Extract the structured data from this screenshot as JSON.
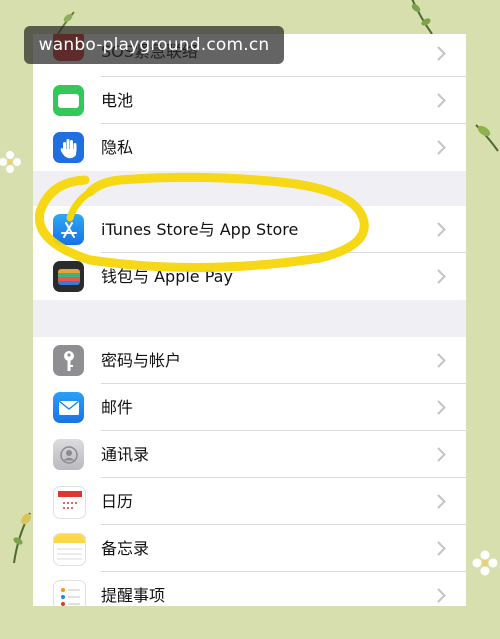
{
  "watermark": "wanbo-playground.com.cn",
  "settings": {
    "group1": [
      {
        "label": "SOS紧急联络",
        "icon": "sos-icon",
        "color": "#e3342f"
      },
      {
        "label": "电池",
        "icon": "battery-icon",
        "color": "#34c759"
      },
      {
        "label": "隐私",
        "icon": "hand-icon",
        "color": "#1f6fe0"
      }
    ],
    "group2": [
      {
        "label": "iTunes Store与 App Store",
        "icon": "app-store-icon",
        "color": "#1a8cf0"
      },
      {
        "label": "钱包与 Apple Pay",
        "icon": "wallet-icon",
        "color": "#2b2b2b"
      }
    ],
    "group3": [
      {
        "label": "密码与帐户",
        "icon": "key-icon",
        "color": "#8e8e93"
      },
      {
        "label": "邮件",
        "icon": "mail-icon",
        "color": "#1a8cf0"
      },
      {
        "label": "通讯录",
        "icon": "contacts-icon",
        "color": "#c7c7cc"
      },
      {
        "label": "日历",
        "icon": "calendar-icon",
        "color": "#ffffff"
      },
      {
        "label": "备忘录",
        "icon": "notes-icon",
        "color": "#ffd84a"
      },
      {
        "label": "提醒事项",
        "icon": "reminders-icon",
        "color": "#ffffff"
      }
    ]
  },
  "annotation_color": "#f5d60a"
}
